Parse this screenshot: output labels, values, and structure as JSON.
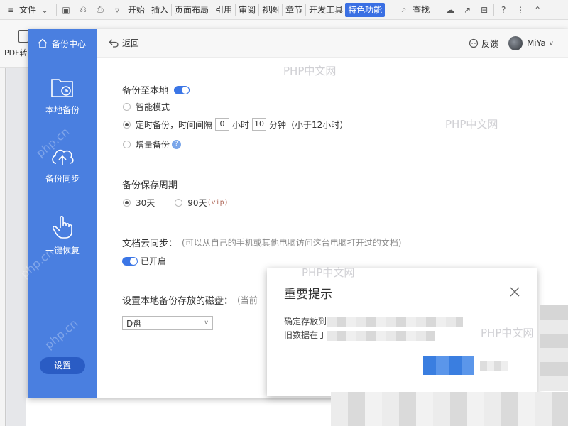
{
  "ribbon": {
    "file_menu": "文件",
    "tabs": [
      "开始",
      "插入",
      "页面布局",
      "引用",
      "审阅",
      "视图",
      "章节",
      "开发工具"
    ],
    "active_tab": "特色功能",
    "search": "查找"
  },
  "toolbar": {
    "pdf_label": "PDF转"
  },
  "backup": {
    "sidebar": {
      "header": "备份中心",
      "items": [
        {
          "label": "本地备份",
          "icon": "folder-clock-icon"
        },
        {
          "label": "备份同步",
          "icon": "cloud-upload-icon"
        },
        {
          "label": "一键恢复",
          "icon": "hand-pointer-icon"
        }
      ],
      "settings": "设置"
    },
    "topbar": {
      "back": "返回",
      "feedback": "反馈",
      "user": "MiYa"
    },
    "local": {
      "title": "备份至本地",
      "options": {
        "smart": "智能模式",
        "scheduled_prefix": "定时备份，时间间隔",
        "hours": "0",
        "hours_unit": "小时",
        "minutes": "10",
        "minutes_unit": "分钟（小于12小时）",
        "incremental": "增量备份"
      }
    },
    "retention": {
      "title": "备份保存周期",
      "opt30": "30天",
      "opt90": "90天",
      "vip": "(vip)"
    },
    "cloud": {
      "title": "文档云同步：",
      "hint": "(可以从自己的手机或其他电脑访问这台电脑打开过的文档)",
      "status": "已开启"
    },
    "disk": {
      "title": "设置本地备份存放的磁盘：",
      "hint": "(当前",
      "value": "D盘"
    }
  },
  "notice": {
    "title": "重要提示",
    "line1": "确定存放到",
    "line2": "旧数据在丁"
  },
  "watermarks": [
    "PHP中文网",
    "php.cn"
  ],
  "colors": {
    "sidebar": "#4a7fe0",
    "accent": "#3b76e6",
    "active_tab": "#3a6fe3"
  }
}
